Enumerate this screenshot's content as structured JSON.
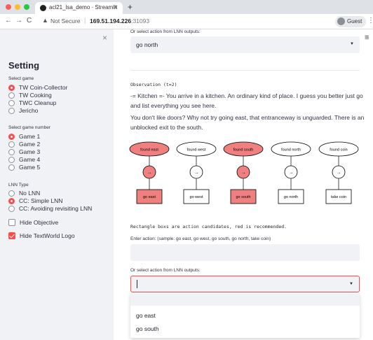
{
  "browser": {
    "tab_title": "acl21_lsa_demo · Streamlit",
    "tab_close": "×",
    "new_tab": "+",
    "nav_back": "←",
    "nav_forward": "→",
    "nav_reload": "C",
    "warning_icon": "▲",
    "not_secure": "Not Secure",
    "url_host": "169.51.194.226",
    "url_port": ":31093",
    "guest": "Guest",
    "menu": "⋮"
  },
  "sidebar": {
    "close": "×",
    "title": "Setting",
    "game_label": "Select game",
    "games": [
      "TW Coin-Collector",
      "TW Cooking",
      "TWC Cleanup",
      "Jericho"
    ],
    "game_selected": 0,
    "number_label": "Select game number",
    "numbers": [
      "Game 1",
      "Game 2",
      "Game 3",
      "Game 4",
      "Game 5"
    ],
    "number_selected": 0,
    "lnn_label": "LNN Type",
    "lnn_types": [
      "No LNN",
      "CC: Simple LNN",
      "CC: Avoiding revisiting LNN"
    ],
    "lnn_selected": 1,
    "hide_objective": "Hide Objective",
    "hide_objective_checked": false,
    "hide_logo": "Hide TextWorld Logo",
    "hide_logo_checked": true
  },
  "main": {
    "hamburger": "≡",
    "top_select_label": "Or select action from LNN outputs:",
    "top_select_value": "go north",
    "caret": "▼",
    "observation_heading": "Observation (t=2)",
    "observation_p1": "-= Kitchen =- You arrive in a kitchen. An ordinary kind of place. I guess you better just go and list everything you see here.",
    "observation_p2": "You don't like doors? Why not try going east, that entranceway is unguarded. There is an unblocked exit to the south.",
    "diagram": {
      "facts": [
        "found east",
        "found west",
        "found south",
        "found north",
        "found coin"
      ],
      "actions": [
        "go east",
        "go west",
        "go south",
        "go north",
        "take coin"
      ],
      "operator": "→",
      "recommended": [
        true,
        false,
        true,
        false,
        false
      ],
      "red_fill": "#f08080",
      "white_fill": "#ffffff"
    },
    "diagram_note": "Rectangle boxs are action candidates, red is recommended.",
    "enter_label": "Enter action: (sample: go east, go west, go south, go north, take coin)",
    "enter_value": "",
    "bottom_select_label": "Or select action from LNN outputs:",
    "bottom_select_value": "",
    "dropdown_options": [
      "go east",
      "go south"
    ]
  },
  "colors": {
    "accent": "#ff4b4b",
    "sidebar_bg": "#f0f2f6",
    "recommended": "#f08080"
  }
}
